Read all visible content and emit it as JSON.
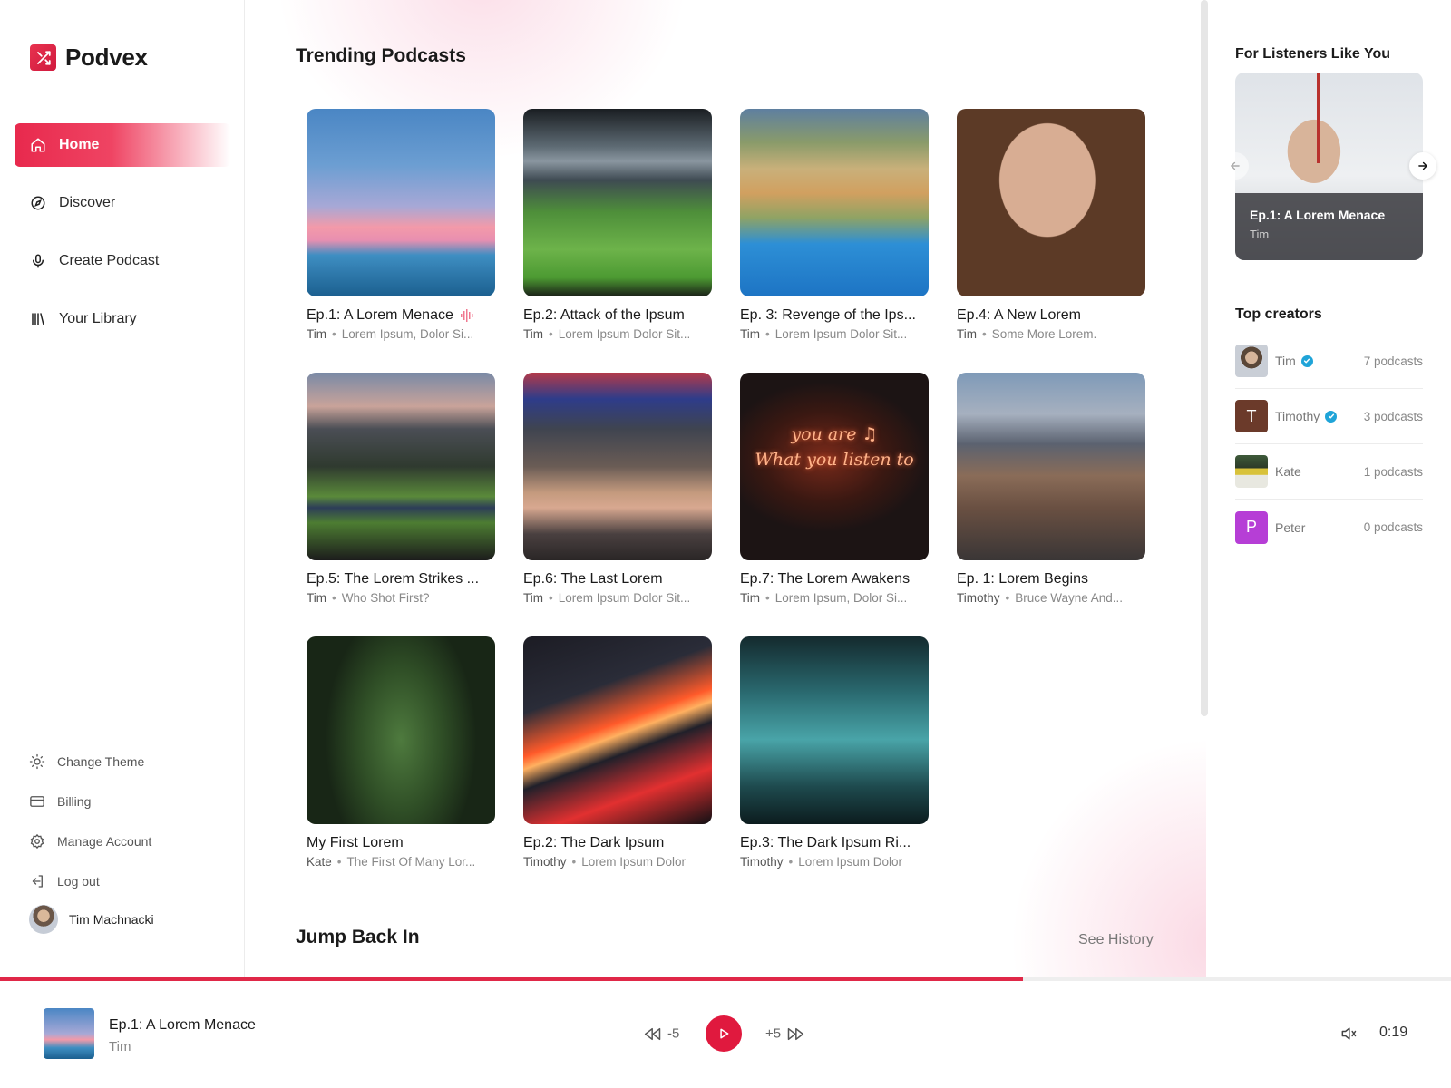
{
  "app": {
    "name": "Podvex"
  },
  "sidebar": {
    "nav": [
      {
        "label": "Home",
        "icon": "home-icon",
        "active": true
      },
      {
        "label": "Discover",
        "icon": "compass-icon"
      },
      {
        "label": "Create Podcast",
        "icon": "microphone-icon"
      },
      {
        "label": "Your Library",
        "icon": "library-icon"
      }
    ],
    "bottom": [
      {
        "label": "Change Theme",
        "icon": "sun-icon"
      },
      {
        "label": "Billing",
        "icon": "credit-card-icon"
      },
      {
        "label": "Manage Account",
        "icon": "gear-icon"
      },
      {
        "label": "Log out",
        "icon": "logout-icon"
      }
    ],
    "user": {
      "name": "Tim Machnacki"
    }
  },
  "main": {
    "trending_title": "Trending Podcasts",
    "jump_back_title": "Jump Back In",
    "see_history": "See History",
    "cards": [
      {
        "title": "Ep.1: A Lorem Menace",
        "author": "Tim",
        "desc": "Lorem Ipsum, Dolor Si...",
        "playing": true
      },
      {
        "title": "Ep.2: Attack of the Ipsum",
        "author": "Tim",
        "desc": "Lorem Ipsum Dolor Sit..."
      },
      {
        "title": "Ep. 3: Revenge of the Ips...",
        "author": "Tim",
        "desc": "Lorem Ipsum Dolor Sit..."
      },
      {
        "title": "Ep.4: A New Lorem",
        "author": "Tim",
        "desc": "Some More Lorem."
      },
      {
        "title": "Ep.5: The Lorem Strikes ...",
        "author": "Tim",
        "desc": "Who Shot First?"
      },
      {
        "title": "Ep.6: The Last Lorem",
        "author": "Tim",
        "desc": "Lorem Ipsum Dolor Sit..."
      },
      {
        "title": "Ep.7: The Lorem Awakens",
        "author": "Tim",
        "desc": "Lorem Ipsum, Dolor Si..."
      },
      {
        "title": "Ep. 1: Lorem Begins",
        "author": "Timothy",
        "desc": "Bruce Wayne And..."
      },
      {
        "title": "My First Lorem",
        "author": "Kate",
        "desc": "The First Of Many Lor..."
      },
      {
        "title": "Ep.2: The Dark Ipsum",
        "author": "Timothy",
        "desc": "Lorem Ipsum Dolor"
      },
      {
        "title": "Ep.3: The Dark Ipsum Ri...",
        "author": "Timothy",
        "desc": "Lorem Ipsum Dolor"
      }
    ],
    "neon_line1": "you are ♫",
    "neon_line2": "What you listen to"
  },
  "right": {
    "listeners_title": "For Listeners Like You",
    "feature": {
      "title": "Ep.1: A Lorem Menace",
      "author": "Tim"
    },
    "creators_title": "Top creators",
    "creators": [
      {
        "name": "Tim",
        "count": "7 podcasts",
        "verified": true
      },
      {
        "name": "Timothy",
        "count": "3 podcasts",
        "verified": true,
        "initial": "T"
      },
      {
        "name": "Kate",
        "count": "1 podcasts"
      },
      {
        "name": "Peter",
        "count": "0 podcasts",
        "initial": "P"
      }
    ]
  },
  "player": {
    "title": "Ep.1: A Lorem Menace",
    "author": "Tim",
    "rewind_label": "-5",
    "forward_label": "+5",
    "time": "0:19",
    "progress": 0.705
  },
  "colors": {
    "accent": "#e0193e",
    "verified": "#1fa4d8",
    "timothy_avatar": "#6b3a2a",
    "peter_avatar": "#b63ed6"
  }
}
